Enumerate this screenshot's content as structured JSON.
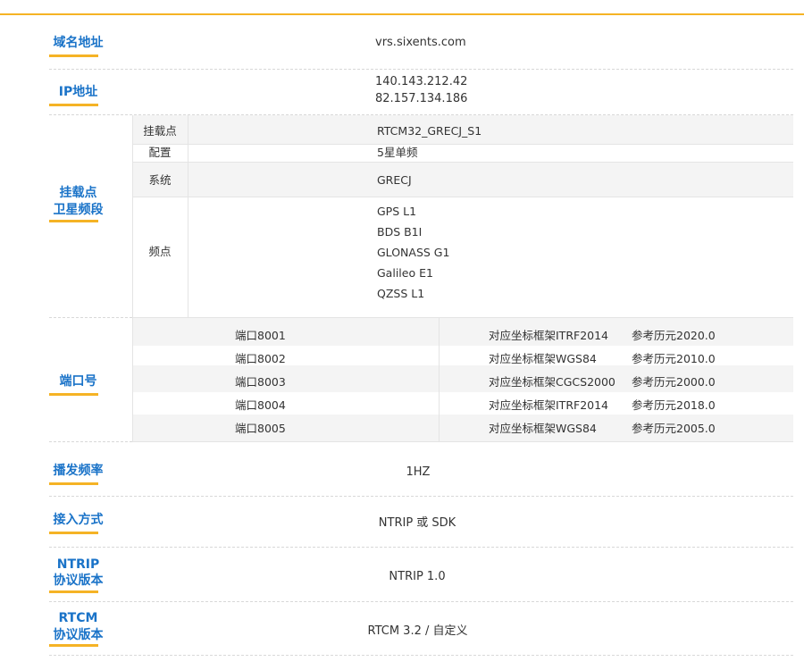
{
  "rows": {
    "domain": {
      "label": "域名地址",
      "value": "vrs.sixents.com"
    },
    "ip": {
      "label": "IP地址",
      "values": [
        "140.143.212.42",
        "82.157.134.186"
      ]
    },
    "mount": {
      "label_line1": "挂载点",
      "label_line2": "卫星频段",
      "sub": [
        {
          "key": "挂载点",
          "value": "RTCM32_GRECJ_S1"
        },
        {
          "key": "配置",
          "value": "5星单频"
        },
        {
          "key": "系统",
          "value": "GRECJ"
        }
      ],
      "freq_key": "频点",
      "freqs": [
        "GPS  L1",
        "BDS  B1I",
        "GLONASS  G1",
        "Galileo  E1",
        "QZSS  L1"
      ]
    },
    "ports": {
      "label": "端口号",
      "items": [
        {
          "port": "端口8001",
          "frame": "对应坐标框架ITRF2014",
          "epoch": "参考历元2020.0"
        },
        {
          "port": "端口8002",
          "frame": "对应坐标框架WGS84",
          "epoch": "参考历元2010.0"
        },
        {
          "port": "端口8003",
          "frame": "对应坐标框架CGCS2000",
          "epoch": "参考历元2000.0"
        },
        {
          "port": "端口8004",
          "frame": "对应坐标框架ITRF2014",
          "epoch": "参考历元2018.0"
        },
        {
          "port": "端口8005",
          "frame": "对应坐标框架WGS84",
          "epoch": "参考历元2005.0"
        }
      ]
    },
    "rate": {
      "label": "播发频率",
      "value": "1HZ"
    },
    "access": {
      "label": "接入方式",
      "value": "NTRIP 或 SDK"
    },
    "ntrip": {
      "label_line1": "NTRIP",
      "label_line2": "协议版本",
      "value": "NTRIP 1.0"
    },
    "rtcm": {
      "label_line1": "RTCM",
      "label_line2": "协议版本",
      "value": "RTCM 3.2 / 自定义"
    }
  },
  "colors": {
    "accent": "#f5b325",
    "label": "#1a73c8",
    "stripe": "#f4f4f4"
  }
}
